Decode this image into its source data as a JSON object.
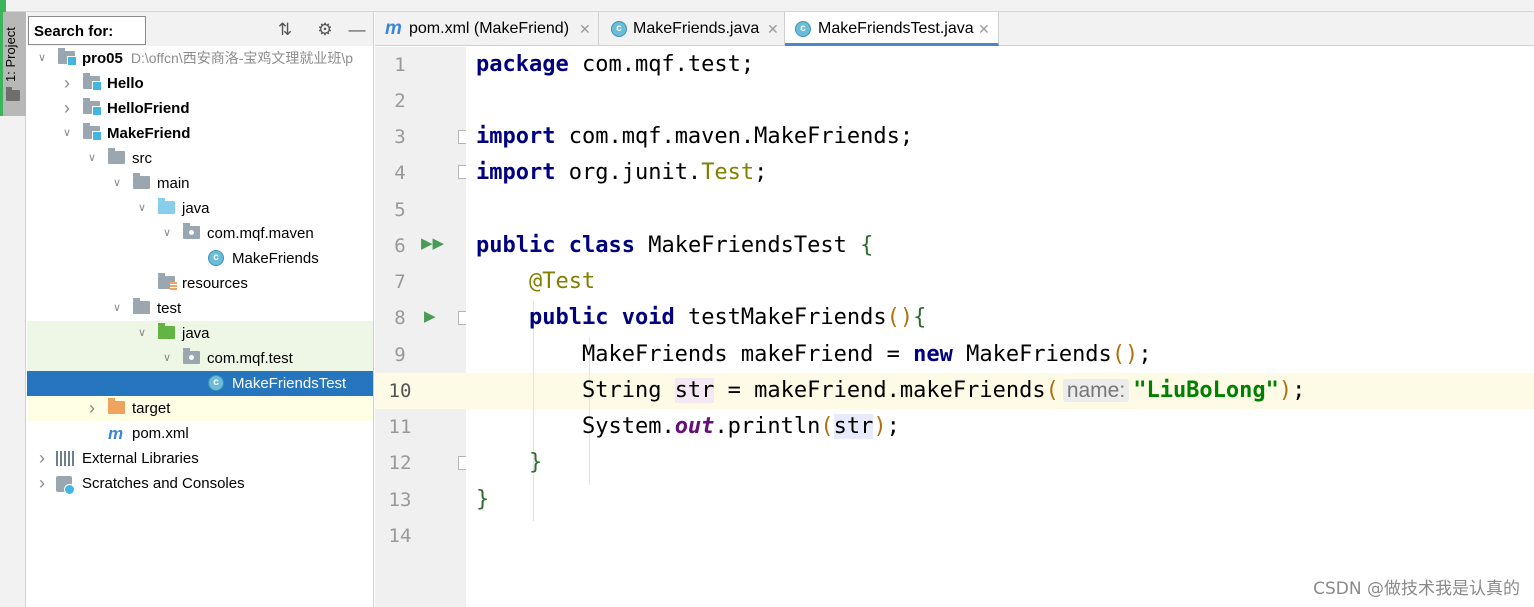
{
  "sidebar_tab": {
    "label": "1: Project"
  },
  "project_panel": {
    "search_label": "Search for:",
    "tree": [
      {
        "label": "pro05",
        "extra": "D:\\offcn\\西安商洛-宝鸡文理就业班\\p",
        "depth": 0,
        "expanded": true,
        "icon": "folder-module-icon",
        "bold": true
      },
      {
        "label": "Hello",
        "depth": 1,
        "expanded": false,
        "icon": "folder-module-icon",
        "bold": true
      },
      {
        "label": "HelloFriend",
        "depth": 1,
        "expanded": false,
        "icon": "folder-module-icon",
        "bold": true
      },
      {
        "label": "MakeFriend",
        "depth": 1,
        "expanded": true,
        "icon": "folder-module-icon",
        "bold": true
      },
      {
        "label": "src",
        "depth": 2,
        "expanded": true,
        "icon": "folder-icon"
      },
      {
        "label": "main",
        "depth": 3,
        "expanded": true,
        "icon": "folder-icon"
      },
      {
        "label": "java",
        "depth": 4,
        "expanded": true,
        "icon": "source-folder-icon"
      },
      {
        "label": "com.mqf.maven",
        "depth": 5,
        "expanded": true,
        "icon": "package-icon"
      },
      {
        "label": "MakeFriends",
        "depth": 6,
        "icon": "class-icon"
      },
      {
        "label": "resources",
        "depth": 4,
        "icon": "resources-folder-icon"
      },
      {
        "label": "test",
        "depth": 3,
        "expanded": true,
        "icon": "folder-icon"
      },
      {
        "label": "java",
        "depth": 4,
        "expanded": true,
        "icon": "test-source-folder-icon",
        "state": "test"
      },
      {
        "label": "com.mqf.test",
        "depth": 5,
        "expanded": true,
        "icon": "package-icon",
        "state": "test"
      },
      {
        "label": "MakeFriendsTest",
        "depth": 6,
        "icon": "test-class-icon",
        "state": "selected"
      },
      {
        "label": "target",
        "depth": 2,
        "expanded": false,
        "icon": "excluded-folder-icon",
        "state": "excluded"
      },
      {
        "label": "pom.xml",
        "depth": 2,
        "icon": "maven-icon"
      },
      {
        "label": "External Libraries",
        "depth": 0,
        "expanded": false,
        "icon": "libraries-icon"
      },
      {
        "label": "Scratches and Consoles",
        "depth": 0,
        "expanded": false,
        "icon": "scratches-icon"
      }
    ]
  },
  "editor_tabs": [
    {
      "label": "pom.xml (MakeFriend)",
      "icon": "maven-icon",
      "active": false
    },
    {
      "label": "MakeFriends.java",
      "icon": "class-icon",
      "active": false
    },
    {
      "label": "MakeFriendsTest.java",
      "icon": "test-class-icon",
      "active": true
    }
  ],
  "editor": {
    "line_numbers": [
      "1",
      "2",
      "3",
      "4",
      "5",
      "6",
      "7",
      "8",
      "9",
      "10",
      "11",
      "12",
      "13",
      "14"
    ],
    "current_line": "10",
    "code": {
      "l1_kw": "package",
      "l1_rest": " com.mqf.test;",
      "l3_kw": "import",
      "l3_rest": " com.mqf.maven.MakeFriends;",
      "l4_kw": "import",
      "l4_pre": " org.junit.",
      "l4_ann": "Test",
      "l4_end": ";",
      "l6_kw1": "public",
      "l6_kw2": "class",
      "l6_name": " MakeFriendsTest ",
      "l6_brace": "{",
      "l7_ann": "@Test",
      "l8_kw1": "public",
      "l8_kw2": "void",
      "l8_name": " testMakeFriends",
      "l8_parens": "()",
      "l8_brace": "{",
      "l9_pre": "MakeFriends makeFriend = ",
      "l9_kw": "new",
      "l9_post": " MakeFriends",
      "l9_parens": "()",
      "l9_end": ";",
      "l10_pre": "String ",
      "l10_var": "str",
      "l10_mid": " = makeFriend.makeFriends",
      "l10_open": "(",
      "l10_hint": "name:",
      "l10_str": "\"LiuBoLong\"",
      "l10_close": ")",
      "l10_end": ";",
      "l11_pre": "System.",
      "l11_static": "out",
      "l11_mid": ".println",
      "l11_open": "(",
      "l11_var": "str",
      "l11_close": ")",
      "l11_end": ";",
      "l12_brace": "}",
      "l13_brace": "}"
    }
  },
  "watermark": "CSDN @做技术我是认真的"
}
